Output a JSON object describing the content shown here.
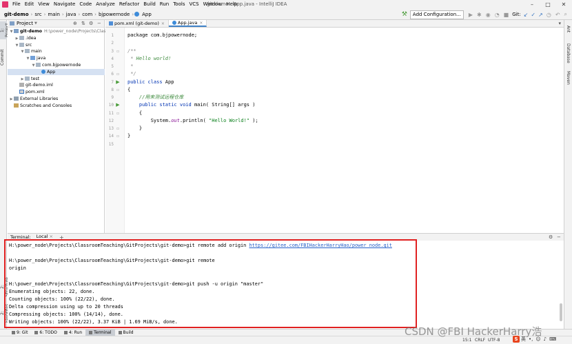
{
  "window": {
    "title": "git-demo - App.java - IntelliJ IDEA",
    "controls": [
      "–",
      "□",
      "✕"
    ]
  },
  "menu": [
    "File",
    "Edit",
    "View",
    "Navigate",
    "Code",
    "Analyze",
    "Refactor",
    "Build",
    "Run",
    "Tools",
    "VCS",
    "Window",
    "Help"
  ],
  "breadcrumb": [
    "git-demo",
    "src",
    "main",
    "java",
    "com",
    "bjpowernode",
    "App"
  ],
  "toolbar": {
    "add_config": "Add Configuration...",
    "git_label": "Git:"
  },
  "project_panel": {
    "title": "Project",
    "tree": [
      {
        "label": "git-demo",
        "extra": "H:\\power_node\\Projects\\Classroo",
        "icon": "module",
        "arrow": "▼",
        "indent": 0
      },
      {
        "label": ".idea",
        "icon": "folder",
        "arrow": "▶",
        "indent": 1
      },
      {
        "label": "src",
        "icon": "folder",
        "arrow": "▼",
        "indent": 1
      },
      {
        "label": "main",
        "icon": "folder",
        "arrow": "▼",
        "indent": 2
      },
      {
        "label": "java",
        "icon": "folder-blue",
        "arrow": "▼",
        "indent": 3
      },
      {
        "label": "com.bjpowernode",
        "icon": "folder",
        "arrow": "▼",
        "indent": 4
      },
      {
        "label": "App",
        "icon": "java-class",
        "arrow": "",
        "indent": 5,
        "selected": true
      },
      {
        "label": "test",
        "icon": "folder",
        "arrow": "▶",
        "indent": 2
      },
      {
        "label": "git-demo.iml",
        "icon": "iml",
        "arrow": "",
        "indent": 1
      },
      {
        "label": "pom.xml",
        "icon": "maven",
        "arrow": "",
        "indent": 1
      },
      {
        "label": "External Libraries",
        "icon": "libs",
        "arrow": "▶",
        "indent": 0
      },
      {
        "label": "Scratches and Consoles",
        "icon": "scratch",
        "arrow": "",
        "indent": 0
      }
    ]
  },
  "editor_tabs": [
    {
      "label": "pom.xml (git-demo)",
      "icon": "m",
      "active": false
    },
    {
      "label": "App.java",
      "icon": "c",
      "active": true
    }
  ],
  "code": {
    "line_numbers": [
      "1",
      "2",
      "3",
      "4",
      "5",
      "6",
      "7",
      "8",
      "9",
      "10",
      "11",
      "12",
      "13",
      "14",
      "15"
    ],
    "lines": [
      [
        {
          "t": "package com.bjpowernode;",
          "c": ""
        }
      ],
      [],
      [
        {
          "t": "/**",
          "c": "doc"
        }
      ],
      [
        {
          "t": " * ",
          "c": "doc"
        },
        {
          "t": "Hello world!",
          "c": "docg"
        }
      ],
      [
        {
          "t": " *",
          "c": "doc"
        }
      ],
      [
        {
          "t": " */",
          "c": "doc"
        }
      ],
      [
        {
          "t": "public class ",
          "c": "kw"
        },
        {
          "t": "App",
          "c": ""
        }
      ],
      [
        {
          "t": "{",
          "c": ""
        }
      ],
      [
        {
          "t": "    //用来测试远程仓库",
          "c": "docg"
        }
      ],
      [
        {
          "t": "    public static void ",
          "c": "kw"
        },
        {
          "t": "main( String[] args )",
          "c": ""
        }
      ],
      [
        {
          "t": "    {",
          "c": ""
        }
      ],
      [
        {
          "t": "        System.",
          "c": ""
        },
        {
          "t": "out",
          "c": "fld"
        },
        {
          "t": ".println( ",
          "c": ""
        },
        {
          "t": "\"Hello World!\"",
          "c": "str"
        },
        {
          "t": " );",
          "c": ""
        }
      ],
      [
        {
          "t": "    }",
          "c": ""
        }
      ],
      [
        {
          "t": "}",
          "c": ""
        }
      ],
      []
    ]
  },
  "terminal": {
    "title": "Terminal:",
    "tab": "Local",
    "lines": [
      {
        "text": "H:\\power_node\\Projects\\ClassroomTeaching\\GitProjects\\git-demo>git remote add origin ",
        "link": "https://gitee.com/FBIHackerHarryHao/power_node.git"
      },
      {
        "text": ""
      },
      {
        "text": "H:\\power_node\\Projects\\ClassroomTeaching\\GitProjects\\git-demo>git remote"
      },
      {
        "text": "origin"
      },
      {
        "text": ""
      },
      {
        "text": "H:\\power_node\\Projects\\ClassroomTeaching\\GitProjects\\git-demo>git push -u origin \"master\""
      },
      {
        "text": "Enumerating objects: 22, done."
      },
      {
        "text": "Counting objects: 100% (22/22), done."
      },
      {
        "text": "Delta compression using up to 20 threads"
      },
      {
        "text": "Compressing objects: 100% (14/14), done."
      },
      {
        "text": "Writing objects: 100% (22/22), 3.37 KiB | 1.69 MiB/s, done."
      }
    ]
  },
  "tool_windows": [
    {
      "label": "9: Git",
      "active": false
    },
    {
      "label": "6: TODO",
      "active": false
    },
    {
      "label": "4: Run",
      "active": false
    },
    {
      "label": "Terminal",
      "active": true
    },
    {
      "label": "Build",
      "active": false
    }
  ],
  "left_tabs": [
    "1: Project",
    "Commit",
    "2: Structure",
    "2: Favorites"
  ],
  "right_tabs": [
    "Ant",
    "Database",
    "Maven"
  ],
  "status": {
    "position": "15:1",
    "line_sep": "CRLF",
    "encoding": "UTF-8"
  },
  "watermark": "CSDN @FBI HackerHarry浩",
  "ime": {
    "badge": "S",
    "lang": "英"
  }
}
